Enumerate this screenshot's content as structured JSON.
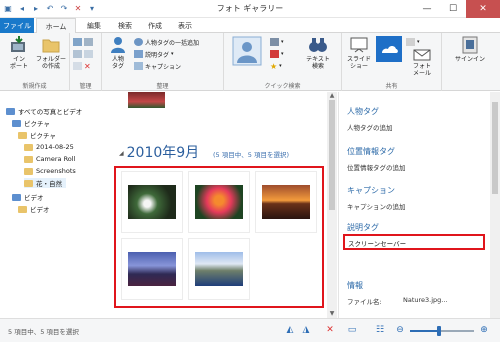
{
  "window": {
    "title": "フォト ギャラリー"
  },
  "tabs": [
    {
      "label": "ファイル"
    },
    {
      "label": "ホーム"
    },
    {
      "label": "編集"
    },
    {
      "label": "検索"
    },
    {
      "label": "作成"
    },
    {
      "label": "表示"
    }
  ],
  "ribbon": {
    "new": {
      "import": "インポート",
      "import_line2": "ポート",
      "import_line1": "イン",
      "folder_line1": "フォルダー",
      "folder_line2": "の作成",
      "label": "新規作成"
    },
    "manage": {
      "label": "管理"
    },
    "organize": {
      "people_line1": "人物",
      "people_line2": "タグ",
      "bulk_people": "人物タグの一括追加",
      "descriptive": "説明タグ",
      "caption": "キャプション",
      "label": "整理"
    },
    "quickfind": {
      "text_search_line1": "テキスト",
      "text_search_line2": "検索",
      "label": "クイック検索"
    },
    "share": {
      "slideshow_line1": "スライド",
      "slideshow_line2": "ショー",
      "photo_mail_line1": "フォト",
      "photo_mail_line2": "メール",
      "label": "共有"
    },
    "signin": "サインイン"
  },
  "nav": {
    "items": [
      {
        "label": "すべての写真とビデオ"
      },
      {
        "label": "ピクチャ"
      },
      {
        "label": "ピクチャ"
      },
      {
        "label": "2014-08-25"
      },
      {
        "label": "Camera Roll"
      },
      {
        "label": "Screenshots"
      },
      {
        "label": "花・自然"
      },
      {
        "label": "ビデオ"
      },
      {
        "label": "ビデオ"
      }
    ]
  },
  "main": {
    "month_title": "2010年9月",
    "month_sub": "(5 項目中、5 項目を選択)"
  },
  "panel": {
    "people_tags_header": "人物タグ",
    "people_tags_value": "人物タグの追加",
    "geo_header": "位置情報タグ",
    "geo_value": "位置情報タグの追加",
    "caption_header": "キャプション",
    "caption_value": "キャプションの追加",
    "desc_header": "説明タグ",
    "desc_value": "スクリーンセーバー",
    "info_header": "情報",
    "filename_label": "ファイル名:",
    "filename_value": "Nature3.jpg..."
  },
  "status": {
    "text": "5 項目中、5 項目を選択",
    "zoom_level": 0.45
  },
  "colors": {
    "accent": "#1979ca",
    "highlight": "#e0151c",
    "link": "#2c6aa8"
  }
}
